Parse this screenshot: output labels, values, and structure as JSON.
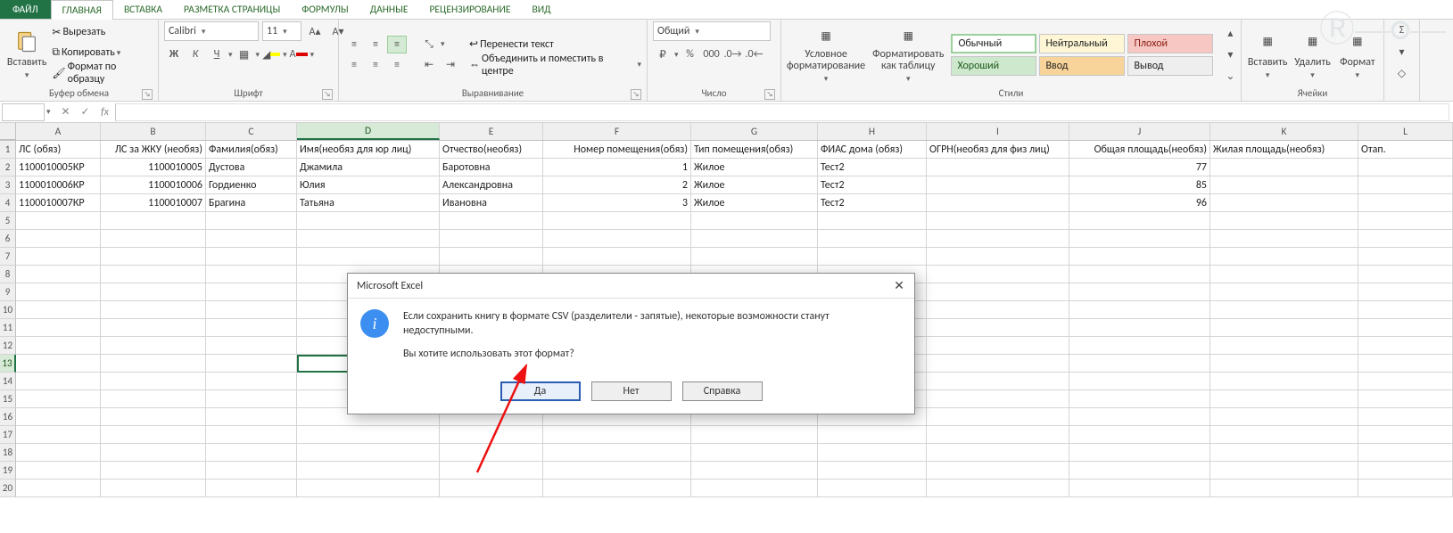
{
  "tabs": {
    "file": "ФАЙЛ",
    "items": [
      "ГЛАВНАЯ",
      "ВСТАВКА",
      "РАЗМЕТКА СТРАНИЦЫ",
      "ФОРМУЛЫ",
      "ДАННЫЕ",
      "РЕЦЕНЗИРОВАНИЕ",
      "ВИД"
    ]
  },
  "ribbon": {
    "clipboard": {
      "title": "Буфер обмена",
      "paste": "Вставить",
      "cut": "Вырезать",
      "copy": "Копировать",
      "format_painter": "Формат по образцу"
    },
    "font": {
      "title": "Шрифт",
      "font_name": "Calibri",
      "font_size": "11"
    },
    "alignment": {
      "title": "Выравнивание",
      "wrap": "Перенести текст",
      "merge": "Объединить и поместить в центре"
    },
    "number": {
      "title": "Число",
      "format": "Общий"
    },
    "styles": {
      "title": "Стили",
      "cond": "Условное форматирование",
      "as_table": "Форматировать как таблицу",
      "normal": "Обычный",
      "neutral": "Нейтральный",
      "bad": "Плохой",
      "good": "Хороший",
      "input": "Ввод",
      "output": "Вывод"
    },
    "cells": {
      "title": "Ячейки",
      "insert": "Вставить",
      "delete": "Удалить",
      "format": "Формат"
    }
  },
  "formula_bar": {
    "fx_label": "fx",
    "value": ""
  },
  "columns": [
    "A",
    "B",
    "C",
    "D",
    "E",
    "F",
    "G",
    "H",
    "I",
    "J",
    "K",
    "L"
  ],
  "selected_column_index": 3,
  "row_numbers": [
    "1",
    "2",
    "3",
    "4",
    "5",
    "6",
    "7",
    "8",
    "9",
    "10",
    "11",
    "12",
    "13",
    "14",
    "15",
    "16",
    "17",
    "18",
    "19",
    "20"
  ],
  "selected_row_index": 12,
  "headers": [
    "ЛС (обяз)",
    "ЛС за ЖКУ (необяз)",
    "Фамилия(обяз)",
    "Имя(необяз для юр лиц)",
    "Отчество(необяз)",
    "Номер помещения(обяз)",
    "Тип помещения(обяз)",
    "ФИАС дома (обяз)",
    "ОГРН(необяз для физ лиц)",
    "Общая площадь(необяз)",
    "Жилая площадь(необяз)",
    "Отап."
  ],
  "rows": [
    {
      "A": "1100010005КР",
      "B": "1100010005",
      "C": "Дустова",
      "D": "Джамила",
      "E": "Баротовна",
      "F": "1",
      "G": "Жилое",
      "H": "Тест2",
      "I": "",
      "J": "77",
      "K": ""
    },
    {
      "A": "1100010006КР",
      "B": "1100010006",
      "C": "Гордиенко",
      "D": "Юлия",
      "E": "Александровна",
      "F": "2",
      "G": "Жилое",
      "H": "Тест2",
      "I": "",
      "J": "85",
      "K": ""
    },
    {
      "A": "1100010007КР",
      "B": "1100010007",
      "C": "Брагина",
      "D": "Татьяна",
      "E": "Ивановна",
      "F": "3",
      "G": "Жилое",
      "H": "Тест2",
      "I": "",
      "J": "96",
      "K": ""
    }
  ],
  "dialog": {
    "title": "Microsoft Excel",
    "line1": "Если сохранить книгу в формате CSV (разделители - запятые), некоторые возможности станут недоступными.",
    "line2": "Вы хотите использовать этот формат?",
    "yes": "Да",
    "no": "Нет",
    "help": "Справка"
  }
}
